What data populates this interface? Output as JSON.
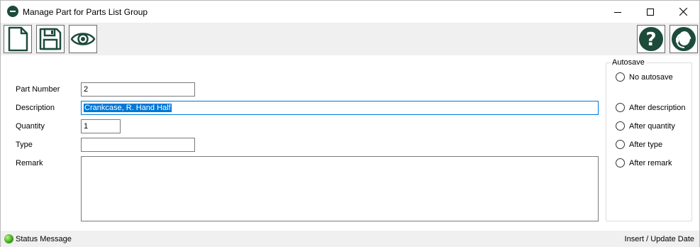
{
  "window": {
    "title": "Manage Part for Parts List Group",
    "app_icon": "app-logo-icon"
  },
  "toolbar": {
    "buttons": [
      {
        "name": "new-document",
        "icon": "new-document-icon"
      },
      {
        "name": "save",
        "icon": "floppy-disk-icon"
      },
      {
        "name": "view",
        "icon": "eye-icon"
      },
      {
        "name": "help",
        "icon": "question-mark-icon"
      },
      {
        "name": "support",
        "icon": "headset-icon"
      }
    ]
  },
  "form": {
    "part_number": {
      "label": "Part Number",
      "value": "2"
    },
    "description": {
      "label": "Description",
      "value": "Crankcase, R. Hand Half"
    },
    "quantity": {
      "label": "Quantity",
      "value": "1"
    },
    "type": {
      "label": "Type",
      "value": ""
    },
    "remark": {
      "label": "Remark",
      "value": ""
    }
  },
  "autosave": {
    "legend": "Autosave",
    "options": [
      {
        "label": "No autosave",
        "checked": false
      },
      {
        "label": "After description",
        "checked": false
      },
      {
        "label": "After quantity",
        "checked": false
      },
      {
        "label": "After type",
        "checked": false
      },
      {
        "label": "After remark",
        "checked": false
      }
    ]
  },
  "status": {
    "message": "Status Message",
    "date_label": "Insert / Update Date",
    "led_color": "#3aa215"
  },
  "colors": {
    "accent": "#1c4b3a",
    "selection": "#0078d7",
    "chrome": "#f0f0f0"
  }
}
